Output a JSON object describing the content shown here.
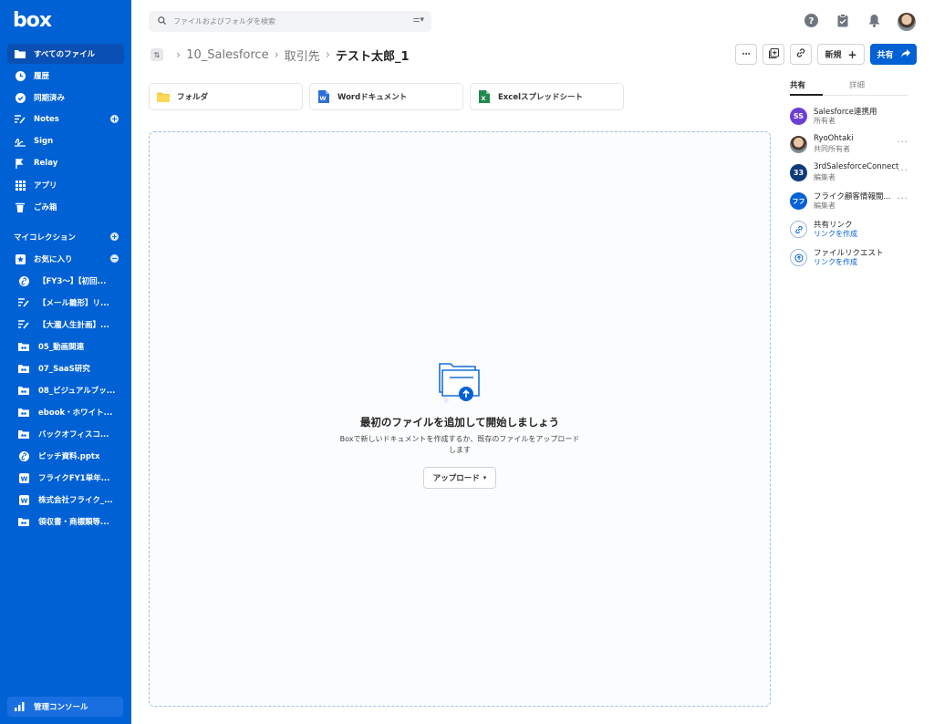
{
  "app": {
    "logo": "box"
  },
  "sidebar": {
    "items": [
      {
        "label": "すべてのファイル",
        "icon": "folder-icon",
        "active": true
      },
      {
        "label": "履歴",
        "icon": "clock-icon"
      },
      {
        "label": "同期済み",
        "icon": "check-circle-icon"
      },
      {
        "label": "Notes",
        "icon": "notes-icon",
        "plus": true
      },
      {
        "label": "Sign",
        "icon": "sign-icon"
      },
      {
        "label": "Relay",
        "icon": "relay-icon"
      },
      {
        "label": "アプリ",
        "icon": "apps-grid-icon"
      },
      {
        "label": "ごみ箱",
        "icon": "trash-icon"
      }
    ],
    "collections_label": "マイコレクション",
    "favorites_label": "お気に入り",
    "favorites": [
      {
        "label": "【FY3〜】【初回...",
        "icon": "web-link-icon"
      },
      {
        "label": "【メール雛形】リ...",
        "icon": "note-icon"
      },
      {
        "label": "【大瀧人生計画】...",
        "icon": "note-icon"
      },
      {
        "label": "05_動画関連",
        "icon": "shared-folder-icon"
      },
      {
        "label": "07_SaaS研究",
        "icon": "shared-folder-icon"
      },
      {
        "label": "08_ビジュアルブッ...",
        "icon": "shared-folder-icon"
      },
      {
        "label": "ebook・ホワイト...",
        "icon": "shared-folder-icon"
      },
      {
        "label": "バックオフィスコ...",
        "icon": "shared-folder-icon"
      },
      {
        "label": "ピッチ資料.pptx",
        "icon": "web-link-icon"
      },
      {
        "label": "フライクFY1単年...",
        "icon": "word-doc-icon"
      },
      {
        "label": "株式会社フライク_...",
        "icon": "word-doc-icon"
      },
      {
        "label": "領収書・商標類等...",
        "icon": "shared-folder-icon"
      }
    ],
    "admin_label": "管理コンソール"
  },
  "search": {
    "placeholder": "ファイルおよびフォルダを検索"
  },
  "breadcrumb": {
    "items": [
      "10_Salesforce",
      "取引先"
    ],
    "current": "テスト太郎_1"
  },
  "toolbar": {
    "more": "⋯",
    "new_label": "新規",
    "share_label": "共有"
  },
  "create_cards": [
    {
      "label": "フォルダ",
      "icon": "folder-icon"
    },
    {
      "label": "Wordドキュメント",
      "icon": "word-icon"
    },
    {
      "label": "Excelスプレッドシート",
      "icon": "excel-icon"
    }
  ],
  "empty_state": {
    "title": "最初のファイルを追加して開始しましょう",
    "description": "Boxで新しいドキュメントを作成するか、既存のファイルをアップロードします",
    "upload_label": "アップロード"
  },
  "right_panel": {
    "tabs": [
      "共有",
      "詳細"
    ],
    "collaborators": [
      {
        "initials": "SS",
        "name": "Salesforce連携用",
        "role": "所有者",
        "color": "#6b3fd4",
        "more": false
      },
      {
        "initials": "",
        "name": "RyoOhtaki",
        "role": "共同所有者",
        "color": "#7f8c96",
        "more": true
      },
      {
        "initials": "33",
        "name": "3rdSalesforceConnect",
        "role": "編集者",
        "color": "#0e3b78",
        "more": true
      },
      {
        "initials": "フフ",
        "name": "フライク顧客情報閲...",
        "role": "編集者",
        "color": "#0061d5",
        "more": true
      }
    ],
    "shared_link": {
      "title": "共有リンク",
      "action": "リンクを作成"
    },
    "file_request": {
      "title": "ファイルリクエスト",
      "action": "リンクを作成"
    }
  },
  "colors": {
    "brand": "#0061d5",
    "sidebar_active": "#0a4fb3"
  }
}
